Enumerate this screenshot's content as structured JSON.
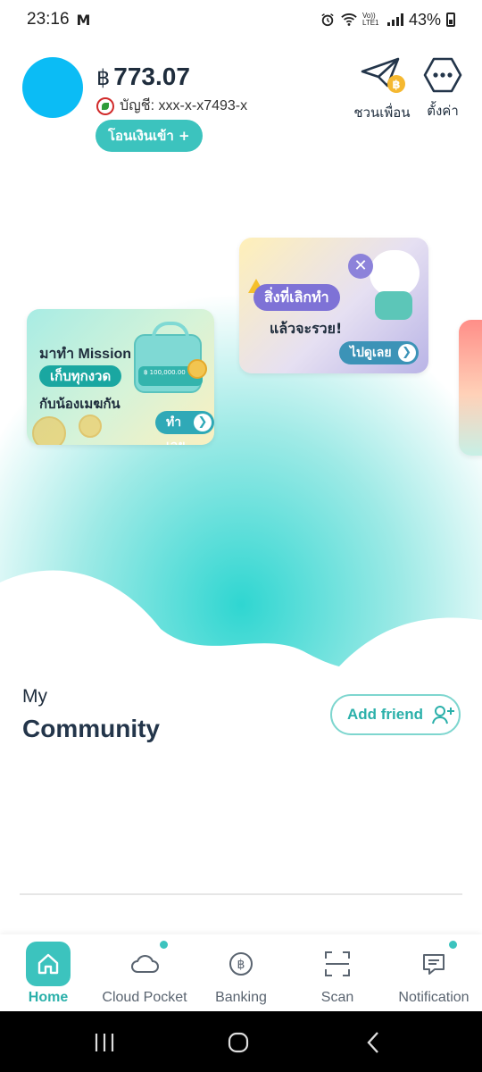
{
  "status_bar": {
    "time": "23:16",
    "mail_icon": "M",
    "battery": "43%",
    "lte_label": "Vo)) LTE1"
  },
  "header": {
    "currency_symbol": "฿",
    "balance": "773.07",
    "account": "บัญชี: xxx-x-x7493-x",
    "transfer_button": "โอนเงินเข้า +",
    "invite_label": "ชวนเพื่อน",
    "settings_label": "ตั้งค่า"
  },
  "promos": [
    {
      "title": "มาทำ Mission",
      "pill": "เก็บทุกงวด",
      "subtitle": "กับน้องเมฆกัน",
      "card_amount": "฿ 100,000.00",
      "button": "ทำเลย"
    },
    {
      "pill": "สิ่งที่เลิกทำ",
      "subtitle": "แล้วจะรวย!",
      "button": "ไปดูเลย"
    }
  ],
  "community": {
    "my_label": "My",
    "title": "Community",
    "add_friend": "Add friend"
  },
  "bottom_nav": {
    "items": [
      {
        "label": "Home",
        "icon": "home-icon",
        "active": true
      },
      {
        "label": "Cloud Pocket",
        "icon": "cloud-icon",
        "badge": true
      },
      {
        "label": "Banking",
        "icon": "baht-icon"
      },
      {
        "label": "Scan",
        "icon": "scan-icon"
      },
      {
        "label": "Notification",
        "icon": "chat-icon",
        "badge": true
      }
    ]
  },
  "colors": {
    "accent": "#3cc3be",
    "avatar": "#0bbcf5",
    "text_dark": "#1f2d3d"
  }
}
